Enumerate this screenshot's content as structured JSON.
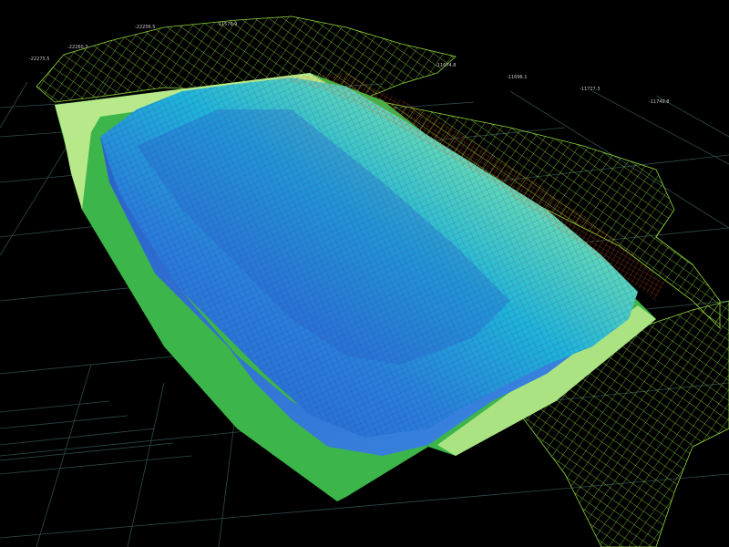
{
  "scene": {
    "background_color": "#000000",
    "ground_grid_color": "#2e4a4a",
    "terrain_wire_color": "#9adf3a",
    "pit_base_color": "#3cb54a",
    "pit_base_light_color": "#b7e88a",
    "pit_wall_color": "#2f6fd0",
    "surface_gradient": [
      "#2d5bd1",
      "#1fa3d8",
      "#3fd0c8",
      "#c8e05a",
      "#e8d84a",
      "#e07a2a"
    ]
  },
  "axis_ticks": [
    {
      "id": "t1",
      "text": "-22256.5"
    },
    {
      "id": "t2",
      "text": "-22260.3"
    },
    {
      "id": "t3",
      "text": "-22275.5"
    },
    {
      "id": "t4",
      "text": "-11576.9"
    },
    {
      "id": "t5",
      "text": "-11674.8"
    },
    {
      "id": "t6",
      "text": "-11696.1"
    },
    {
      "id": "t7",
      "text": "-11727.3"
    },
    {
      "id": "t8",
      "text": "-11749.8"
    }
  ]
}
